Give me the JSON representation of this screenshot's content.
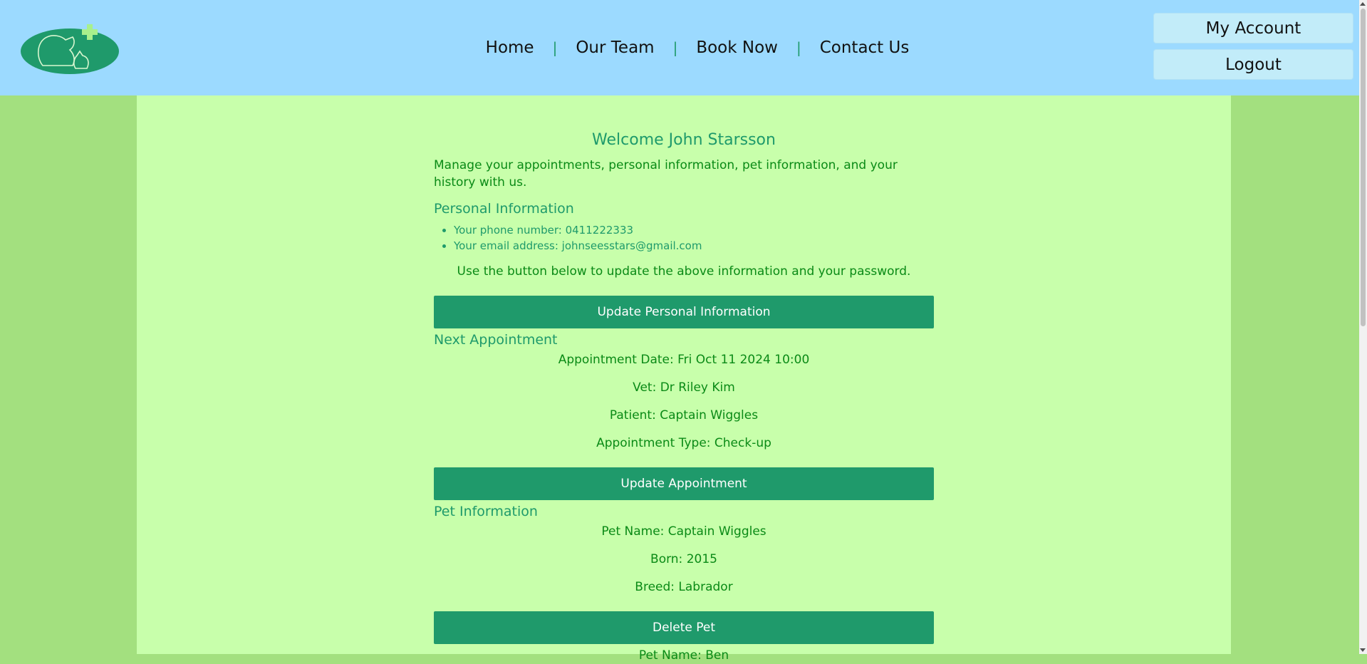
{
  "nav": {
    "items": [
      "Home",
      "Our Team",
      "Book Now",
      "Contact Us"
    ],
    "separator": "|"
  },
  "account": {
    "my_account": "My Account",
    "logout": "Logout"
  },
  "welcome": {
    "title": "Welcome John Starsson",
    "intro": "Manage your appointments, personal information, pet information, and your history with us."
  },
  "personal": {
    "heading": "Personal Information",
    "phone": "Your phone number: 0411222333",
    "email": "Your email address: johnseesstars@gmail.com",
    "note": "Use the button below to update the above information and your password.",
    "button": "Update Personal Information"
  },
  "appointment": {
    "heading": "Next Appointment",
    "date": "Appointment Date: Fri Oct 11 2024 10:00",
    "vet": "Vet: Dr Riley Kim",
    "patient": "Patient: Captain Wiggles",
    "type": "Appointment Type: Check-up",
    "button": "Update Appointment"
  },
  "pets": {
    "heading": "Pet Information",
    "items": [
      {
        "name": "Pet Name: Captain Wiggles",
        "born": "Born: 2015",
        "breed": "Breed: Labrador",
        "button": "Delete Pet"
      },
      {
        "name": "Pet Name: Ben"
      }
    ]
  },
  "colors": {
    "header_bg": "#9cdaff",
    "page_bg": "#a3e07f",
    "content_bg": "#c8ffab",
    "accent": "#1f9a6b",
    "text_green": "#0a8a16"
  }
}
